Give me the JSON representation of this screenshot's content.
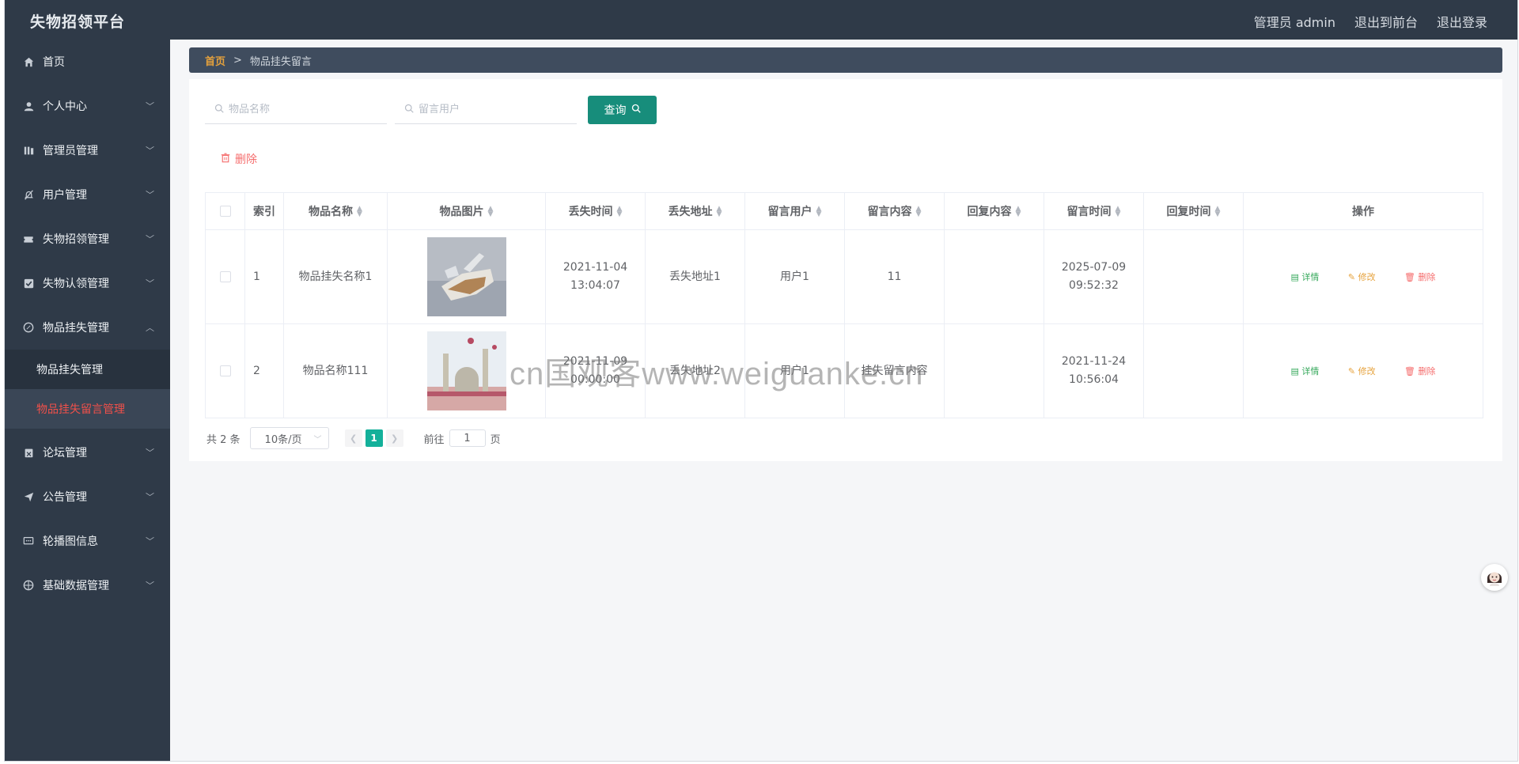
{
  "header": {
    "title": "失物招领平台",
    "admin_label": "管理员 admin",
    "back_front": "退出到前台",
    "logout": "退出登录"
  },
  "sidebar": {
    "items": [
      {
        "label": "首页",
        "icon": "home-icon"
      },
      {
        "label": "个人中心",
        "icon": "user-icon"
      },
      {
        "label": "管理员管理",
        "icon": "bars-icon"
      },
      {
        "label": "用户管理",
        "icon": "bell-off-icon"
      },
      {
        "label": "失物招领管理",
        "icon": "ticket-icon"
      },
      {
        "label": "失物认领管理",
        "icon": "check-square-icon"
      },
      {
        "label": "物品挂失管理",
        "icon": "compass-icon"
      },
      {
        "label": "论坛管理",
        "icon": "calendar-x-icon"
      },
      {
        "label": "公告管理",
        "icon": "send-icon"
      },
      {
        "label": "轮播图信息",
        "icon": "chat-icon"
      },
      {
        "label": "基础数据管理",
        "icon": "globe-icon"
      }
    ],
    "submenu": [
      {
        "label": "物品挂失管理"
      },
      {
        "label": "物品挂失留言管理"
      }
    ]
  },
  "breadcrumb": {
    "home": "首页",
    "separator": ">",
    "current": "物品挂失留言"
  },
  "search": {
    "item_name_placeholder": "物品名称",
    "user_placeholder": "留言用户",
    "query_label": "查询"
  },
  "toolbar": {
    "delete_label": "删除"
  },
  "table": {
    "columns": [
      "索引",
      "物品名称",
      "物品图片",
      "丢失时间",
      "丢失地址",
      "留言用户",
      "留言内容",
      "回复内容",
      "留言时间",
      "回复时间",
      "操作"
    ],
    "rows": [
      {
        "index": "1",
        "name": "物品挂失名称1",
        "lost_time": "2021-11-04 13:04:07",
        "lost_address": "丢失地址1",
        "user": "用户1",
        "content": "11",
        "reply": "",
        "msg_time": "2025-07-09 09:52:32",
        "reply_time": ""
      },
      {
        "index": "2",
        "name": "物品名称111",
        "lost_time": "2021-11-09 00:00:00",
        "lost_address": "丢失地址2",
        "user": "用户1",
        "content": "挂失留言内容",
        "reply": "",
        "msg_time": "2021-11-24 10:56:04",
        "reply_time": ""
      }
    ],
    "actions": {
      "detail": "详情",
      "edit": "修改",
      "delete": "删除"
    }
  },
  "pagination": {
    "total": "共 2 条",
    "page_size": "10条/页",
    "current_page": "1",
    "goto_label": "前往",
    "goto_value": "1",
    "page_suffix": "页"
  },
  "watermark": "cn国观客www.weiguanke.cn",
  "colors": {
    "sidebar_bg": "#2f3a48",
    "accent": "#178d7b",
    "active_menu": "#f0504a",
    "danger": "#f56c6c"
  }
}
